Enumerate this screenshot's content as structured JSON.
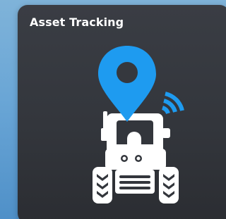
{
  "card": {
    "title": "Asset Tracking"
  },
  "icons": {
    "main": "tractor-icon",
    "pin": "location-pin-icon",
    "signal": "wifi-signal-icon"
  },
  "colors": {
    "accent": "#1e9bf0",
    "icon": "#ffffff",
    "card": "#35383e"
  }
}
